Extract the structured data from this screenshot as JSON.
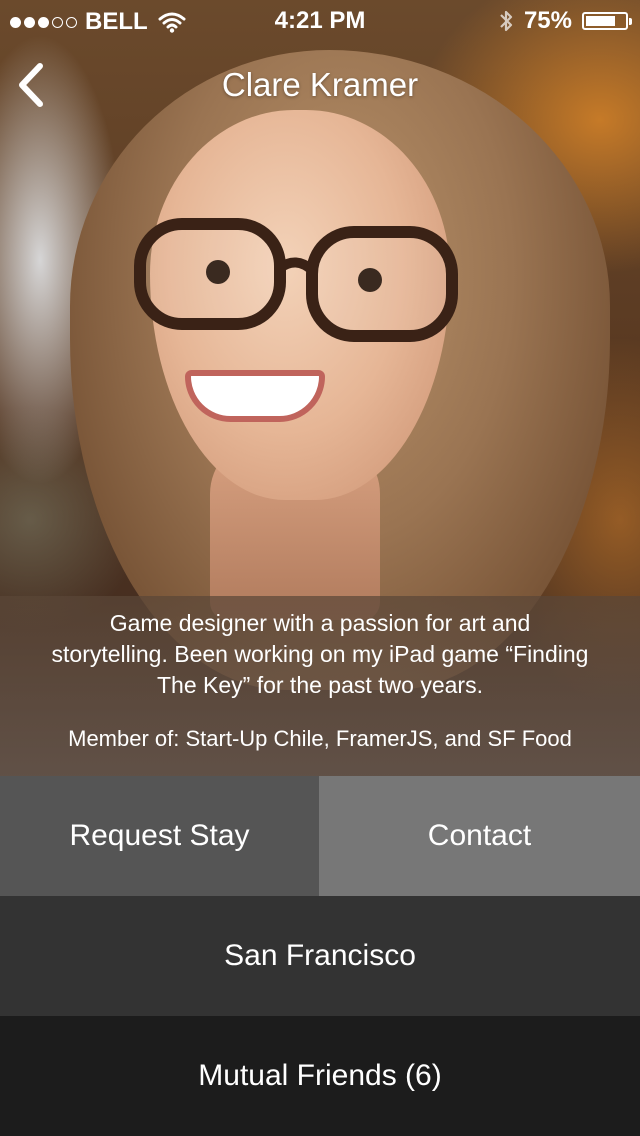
{
  "status_bar": {
    "carrier": "BELL",
    "signal_bars_filled": 3,
    "signal_bars_total": 5,
    "time": "4:21 PM",
    "battery_percent_label": "75%",
    "battery_level": 0.75
  },
  "nav": {
    "title": "Clare Kramer",
    "back_icon": "chevron-left-icon"
  },
  "profile": {
    "bio": "Game designer with a passion for art and storytelling. Been working on my iPad game “Finding The Key” for the past two years.",
    "member_of": "Member of: Start-Up Chile, FramerJS, and SF Food"
  },
  "actions": {
    "request_stay": "Request Stay",
    "contact": "Contact",
    "location": "San Francisco",
    "mutual_friends": "Mutual Friends (6)"
  },
  "colors": {
    "request_bg": "#555555",
    "contact_bg": "#777777",
    "location_bg": "#333333",
    "friends_bg": "#1c1c1c"
  }
}
